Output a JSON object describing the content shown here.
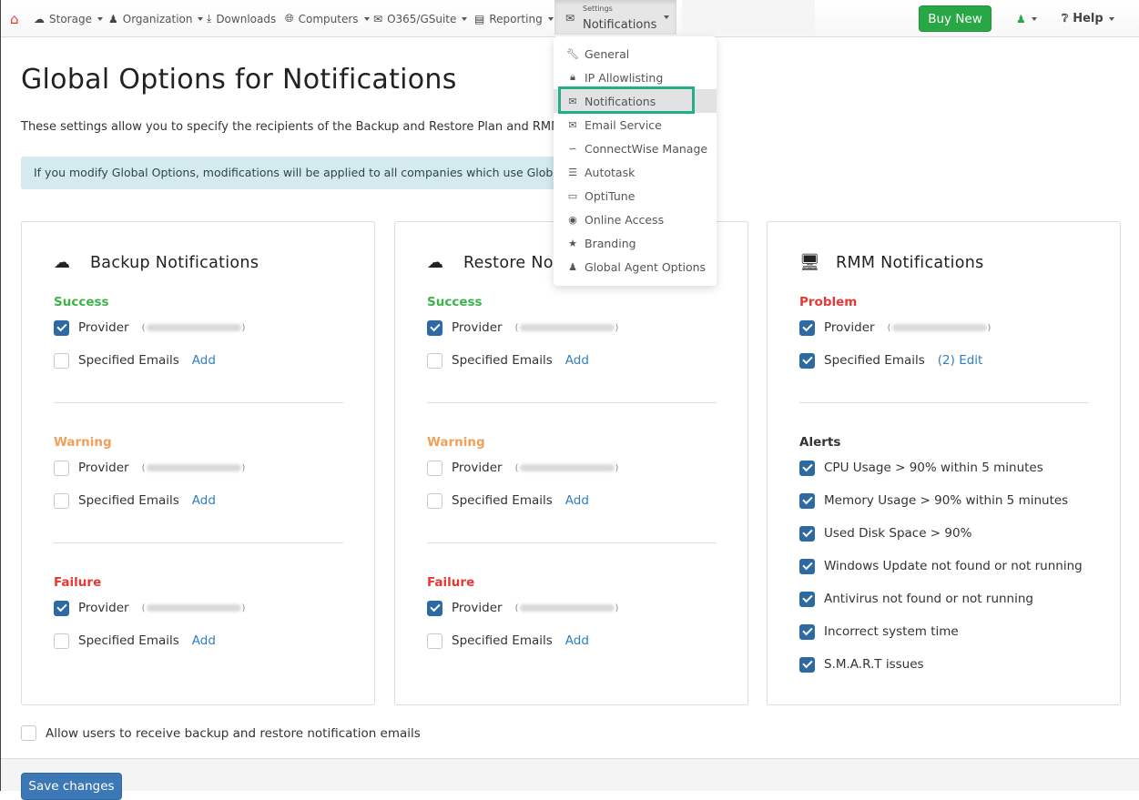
{
  "navbar": {
    "home_icon": "home-icon",
    "items": [
      {
        "label": "Storage",
        "icon": "cloud-icon",
        "dropdown": true
      },
      {
        "label": "Organization",
        "icon": "user-icon",
        "dropdown": true
      },
      {
        "label": "Downloads",
        "icon": "download-icon",
        "dropdown": false
      },
      {
        "label": "Computers",
        "icon": "globe-icon",
        "dropdown": true
      },
      {
        "label": "O365/GSuite",
        "icon": "envelope-icon",
        "dropdown": true
      },
      {
        "label": "Reporting",
        "icon": "bar-chart-icon",
        "dropdown": true
      }
    ],
    "settings": {
      "small_label": "Settings",
      "label": "Notifications",
      "icon": "envelope-icon"
    },
    "buy_new": "Buy New",
    "user_icon": "user-icon",
    "help": "Help"
  },
  "settings_menu": {
    "items": [
      {
        "label": "General",
        "icon": "wrench-icon"
      },
      {
        "label": "IP Allowlisting",
        "icon": "lock-icon"
      },
      {
        "label": "Notifications",
        "icon": "envelope-icon",
        "active": true
      },
      {
        "label": "Email Service",
        "icon": "envelope-icon"
      },
      {
        "label": "ConnectWise Manage",
        "icon": "rss-icon"
      },
      {
        "label": "Autotask",
        "icon": "server-icon"
      },
      {
        "label": "OptiTune",
        "icon": "laptop-icon"
      },
      {
        "label": "Online Access",
        "icon": "globe-icon"
      },
      {
        "label": "Branding",
        "icon": "star-icon"
      },
      {
        "label": "Global Agent Options",
        "icon": "user-icon"
      }
    ]
  },
  "page": {
    "title": "Global Options for Notifications",
    "intro": "These settings allow you to specify the recipients of the Backup and Restore Plan and RMM",
    "alert": "If you modify Global Options, modifications will be applied to all companies which use Global O"
  },
  "cards": [
    {
      "title": "Backup Notifications",
      "icon": "cloud-download-icon",
      "sections": [
        {
          "label": "Success",
          "color": "green",
          "provider_checked": true,
          "specified_checked": false,
          "specified_link": "Add"
        },
        {
          "label": "Warning",
          "color": "orange",
          "provider_checked": false,
          "specified_checked": false,
          "specified_link": "Add"
        },
        {
          "label": "Failure",
          "color": "red",
          "provider_checked": true,
          "specified_checked": false,
          "specified_link": "Add"
        }
      ]
    },
    {
      "title": "Restore Notifications",
      "icon": "cloud-upload-icon",
      "sections": [
        {
          "label": "Success",
          "color": "green",
          "provider_checked": true,
          "specified_checked": false,
          "specified_link": "Add"
        },
        {
          "label": "Warning",
          "color": "orange",
          "provider_checked": false,
          "specified_checked": false,
          "specified_link": "Add"
        },
        {
          "label": "Failure",
          "color": "red",
          "provider_checked": true,
          "specified_checked": false,
          "specified_link": "Add"
        }
      ]
    },
    {
      "title": "RMM Notifications",
      "icon": "monitor-chart-icon",
      "sections": [
        {
          "label": "Problem",
          "color": "red",
          "provider_checked": true,
          "specified_checked": true,
          "specified_link": "(2) Edit"
        }
      ],
      "alerts_label": "Alerts",
      "alerts": [
        {
          "label": "CPU Usage > 90% within 5 minutes",
          "checked": true
        },
        {
          "label": "Memory Usage > 90% within 5 minutes",
          "checked": true
        },
        {
          "label": "Used Disk Space > 90%",
          "checked": true
        },
        {
          "label": "Windows Update not found or not running",
          "checked": true
        },
        {
          "label": "Antivirus not found or not running",
          "checked": true
        },
        {
          "label": "Incorrect system time",
          "checked": true
        },
        {
          "label": "S.M.A.R.T issues",
          "checked": true
        }
      ]
    }
  ],
  "labels": {
    "provider": "Provider",
    "specified": "Specified Emails"
  },
  "footer": {
    "allow_users_label": "Allow users to receive backup and restore notification emails",
    "allow_users_checked": false,
    "save_label": "Save changes"
  },
  "colors": {
    "green": "#3cb44b",
    "orange": "#f0a057",
    "red": "#e53935",
    "primary": "#2d6aa3",
    "buy": "#28a745",
    "highlight": "#1fae86"
  }
}
